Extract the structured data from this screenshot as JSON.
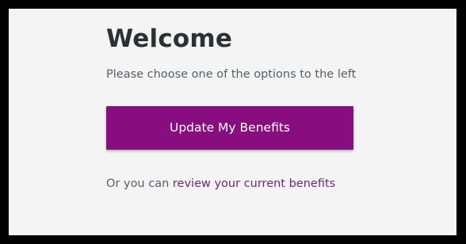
{
  "welcome": {
    "title": "Welcome",
    "subtitle": "Please choose one of the options to the left",
    "primary_button_label": "Update My Benefits",
    "alt_prefix": "Or you can ",
    "alt_link_label": "review your current benefits"
  },
  "colors": {
    "frame": "#000000",
    "panel_background": "#f4f4f4",
    "button_background": "#880e80",
    "link": "#6a2a6e",
    "body_text": "#5a5d61",
    "title_text": "#2c2f33"
  }
}
